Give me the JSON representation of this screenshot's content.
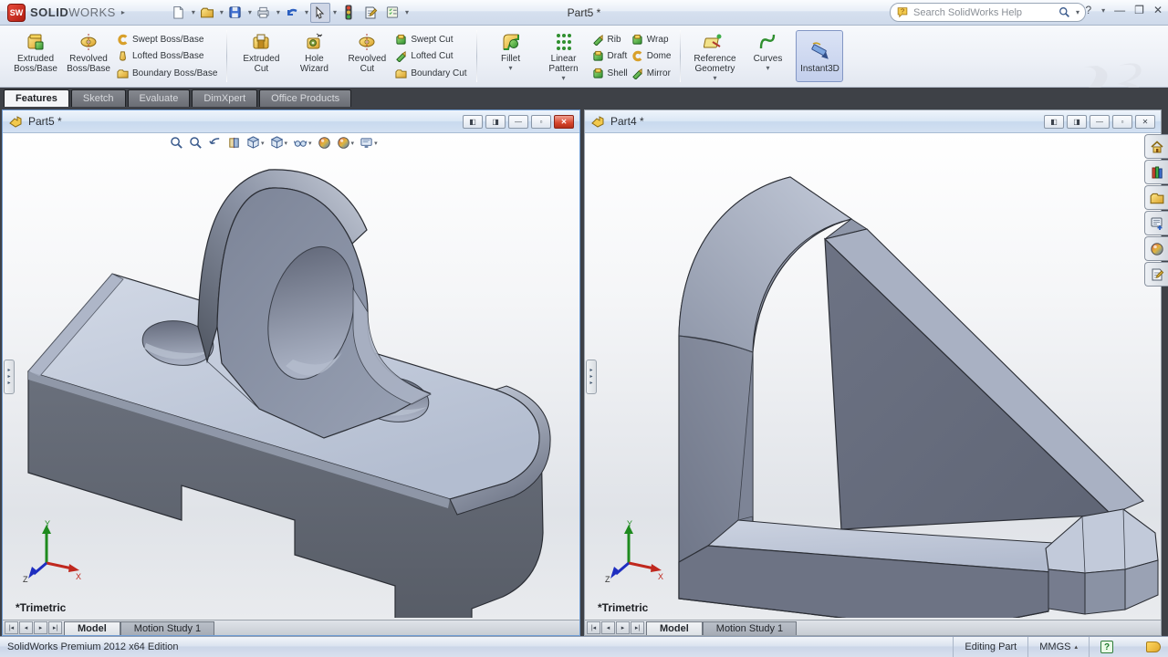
{
  "app": {
    "brand_bold": "SOLID",
    "brand_light": "WORKS",
    "doc_title": "Part5 *",
    "search_placeholder": "Search SolidWorks Help"
  },
  "quick_toolbar_icons": [
    "new-document-icon",
    "open-icon",
    "save-icon",
    "print-icon",
    "undo-icon",
    "select-cursor-icon",
    "rebuild-trafficlight-icon",
    "options-sheet-icon",
    "task-list-icon"
  ],
  "ribbon": {
    "extruded_boss": "Extruded\nBoss/Base",
    "revolved_boss": "Revolved\nBoss/Base",
    "swept_boss": "Swept Boss/Base",
    "lofted_boss": "Lofted Boss/Base",
    "boundary_boss": "Boundary Boss/Base",
    "extruded_cut": "Extruded\nCut",
    "hole_wizard": "Hole\nWizard",
    "revolved_cut": "Revolved\nCut",
    "swept_cut": "Swept Cut",
    "lofted_cut": "Lofted Cut",
    "boundary_cut": "Boundary Cut",
    "fillet": "Fillet",
    "linear_pattern": "Linear\nPattern",
    "rib": "Rib",
    "draft": "Draft",
    "shell": "Shell",
    "wrap": "Wrap",
    "dome": "Dome",
    "mirror": "Mirror",
    "reference_geometry": "Reference\nGeometry",
    "curves": "Curves",
    "instant3d": "Instant3D"
  },
  "command_tabs": [
    "Features",
    "Sketch",
    "Evaluate",
    "DimXpert",
    "Office Products"
  ],
  "hud_icons": [
    "zoom-fit-icon",
    "zoom-area-icon",
    "previous-view-icon",
    "section-view-icon",
    "view-orientation-icon",
    "display-style-icon",
    "hide-show-items-icon",
    "edit-appearance-icon",
    "apply-scene-icon",
    "view-settings-icon"
  ],
  "left_window": {
    "title": "Part5 *",
    "view_orientation_label": "*Trimetric",
    "model_tab": "Model",
    "motion_tab": "Motion Study 1"
  },
  "right_window": {
    "title": "Part4 *",
    "view_orientation_label": "*Trimetric",
    "model_tab": "Model",
    "motion_tab": "Motion Study 1"
  },
  "triad": {
    "x": "X",
    "y": "Y",
    "z": "Z"
  },
  "task_pane_icons": [
    "solidworks-resources-home-icon",
    "design-library-icon",
    "file-explorer-icon",
    "view-palette-icon",
    "appearances-scenes-icon",
    "custom-properties-icon"
  ],
  "status_bar": {
    "product": "SolidWorks Premium 2012 x64 Edition",
    "editing_state": "Editing Part",
    "units": "MMGS"
  },
  "colors": {
    "part_top_face": "#c6cedd",
    "part_front_face": "#5d6370",
    "part_side_face": "#929bae",
    "active_close_button": "#d6442b",
    "instant3d_active_bg": "#cdd8f0",
    "tab_bar_bg": "#3e4147"
  }
}
